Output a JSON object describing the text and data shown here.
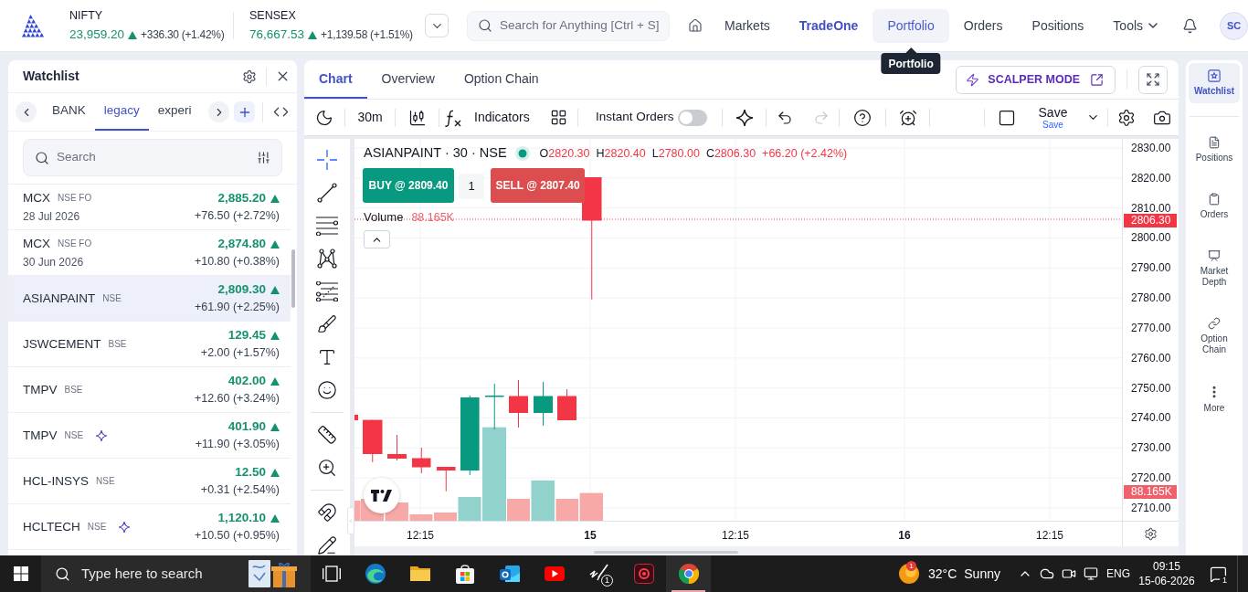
{
  "topbar": {
    "indices": [
      {
        "name": "NIFTY",
        "value": "23,959.20",
        "rising": true,
        "change": "+336.30 (+1.42%)"
      },
      {
        "name": "SENSEX",
        "value": "76,667.53",
        "rising": true,
        "change": "+1,139.58 (+1.51%)"
      }
    ],
    "search": {
      "placeholder": "Search for Anything [Ctrl + S]"
    },
    "nav": [
      {
        "label": "Markets",
        "selected": false,
        "hovered": false,
        "menu": false
      },
      {
        "label": "TradeOne",
        "selected": true,
        "hovered": false,
        "menu": false
      },
      {
        "label": "Portfolio",
        "selected": false,
        "hovered": true,
        "menu": false
      },
      {
        "label": "Orders",
        "selected": false,
        "hovered": false,
        "menu": false
      },
      {
        "label": "Positions",
        "selected": false,
        "hovered": false,
        "menu": false
      },
      {
        "label": "Tools",
        "selected": false,
        "hovered": false,
        "menu": true
      }
    ],
    "tooltip": "Portfolio",
    "avatar": "SC"
  },
  "watchlist": {
    "title": "Watchlist",
    "tabs": [
      {
        "label": "BANK",
        "selected": false
      },
      {
        "label": "legacy",
        "selected": true
      },
      {
        "label": "experi",
        "selected": false
      }
    ],
    "search": {
      "placeholder": "Search"
    },
    "rows": [
      {
        "symbol": "MCX",
        "exchange": "NSE FO",
        "expiry": "28 Jul 2026",
        "price": "2,885.20",
        "rising": true,
        "change": "+76.50 (+2.72%)",
        "selected": false,
        "sparkle": false
      },
      {
        "symbol": "MCX",
        "exchange": "NSE FO",
        "expiry": "30 Jun 2026",
        "price": "2,874.80",
        "rising": true,
        "change": "+10.80 (+0.38%)",
        "selected": false,
        "sparkle": false
      },
      {
        "symbol": "ASIANPAINT",
        "exchange": "NSE",
        "price": "2,809.30",
        "rising": true,
        "change": "+61.90 (+2.25%)",
        "selected": true,
        "sparkle": false
      },
      {
        "symbol": "JSWCEMENT",
        "exchange": "BSE",
        "price": "129.45",
        "rising": true,
        "change": "+2.00 (+1.57%)",
        "selected": false,
        "sparkle": false
      },
      {
        "symbol": "TMPV",
        "exchange": "BSE",
        "price": "402.00",
        "rising": true,
        "change": "+12.60 (+3.24%)",
        "selected": false,
        "sparkle": false
      },
      {
        "symbol": "TMPV",
        "exchange": "NSE",
        "price": "401.90",
        "rising": true,
        "change": "+11.90 (+3.05%)",
        "selected": false,
        "sparkle": true
      },
      {
        "symbol": "HCL-INSYS",
        "exchange": "NSE",
        "price": "12.50",
        "rising": true,
        "change": "+0.31 (+2.54%)",
        "selected": false,
        "sparkle": false
      },
      {
        "symbol": "HCLTECH",
        "exchange": "NSE",
        "price": "1,120.10",
        "rising": true,
        "change": "+10.50 (+0.95%)",
        "selected": false,
        "sparkle": true
      }
    ]
  },
  "chart_panel": {
    "tabs": [
      {
        "label": "Chart",
        "selected": true
      },
      {
        "label": "Overview",
        "selected": false
      },
      {
        "label": "Option Chain",
        "selected": false
      }
    ],
    "scalper_button": "SCALPER MODE",
    "toolbar": {
      "interval": "30m",
      "indicators": "Indicators",
      "instant_orders": {
        "label": "Instant Orders",
        "on": false
      },
      "history": [
        {
          "kind": "undo",
          "disabled": false
        },
        {
          "kind": "redo",
          "disabled": true
        }
      ],
      "save": {
        "label": "Save",
        "caption": "Save"
      }
    },
    "chart": {
      "legend": {
        "symbol": "ASIANPAINT · 30 · NSE",
        "ohlc": [
          {
            "label": "O",
            "value": "2820.30"
          },
          {
            "label": "H",
            "value": "2820.40"
          },
          {
            "label": "L",
            "value": "2780.00"
          },
          {
            "label": "C",
            "value": "2806.30"
          }
        ],
        "change": "+66.20 (+2.42%)"
      },
      "buy_button": "BUY @ 2809.40",
      "quantity": {
        "value": "1"
      },
      "sell_button": "SELL @ 2807.40",
      "volume": {
        "label": "Volume",
        "value": "88.165K"
      },
      "price_labels": [
        "2830.00",
        "2820.00",
        "2810.00",
        "2800.00",
        "2790.00",
        "2780.00",
        "2770.00",
        "2760.00",
        "2750.00",
        "2740.00",
        "2730.00",
        "2720.00",
        "2710.00"
      ],
      "last_price_tag": "2806.30",
      "volume_tag": "88.165K",
      "time_labels": [
        {
          "label": "12:15",
          "kind": "time"
        },
        {
          "label": "15",
          "kind": "day"
        },
        {
          "label": "12:15",
          "kind": "time"
        },
        {
          "label": "16",
          "kind": "day"
        },
        {
          "label": "12:15",
          "kind": "time"
        }
      ]
    }
  },
  "right_sidebar": {
    "items": [
      {
        "kind": "watchlist",
        "label": "Watchlist",
        "selected": true
      },
      {
        "kind": "positions",
        "label": "Positions",
        "selected": false
      },
      {
        "kind": "orders",
        "label": "Orders",
        "selected": false
      },
      {
        "kind": "depth",
        "label": "Market Depth",
        "selected": false
      },
      {
        "kind": "chain",
        "label": "Option Chain",
        "selected": false
      },
      {
        "kind": "more",
        "label": "More",
        "selected": false
      }
    ]
  },
  "taskbar": {
    "search": {
      "placeholder": "Type here to search"
    },
    "apps": [
      {
        "kind": "swirl",
        "active": false
      },
      {
        "kind": "folder",
        "active": false
      },
      {
        "kind": "bag",
        "active": false
      },
      {
        "kind": "mail",
        "active": false
      },
      {
        "kind": "play",
        "active": false
      },
      {
        "kind": "pen",
        "active": false,
        "badge": "1"
      },
      {
        "kind": "record",
        "active": false
      },
      {
        "kind": "tricolor",
        "active": true
      }
    ],
    "weather": {
      "temperature": "32°C",
      "condition": "Sunny",
      "badge": "1"
    },
    "language": "ENG",
    "time": "09:15",
    "date": "15-06-2026",
    "notifications": "1"
  }
}
